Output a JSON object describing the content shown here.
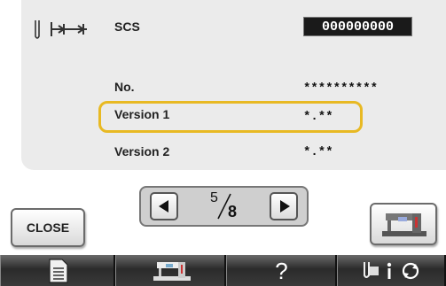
{
  "screen": {
    "header": {
      "icon": "needle-stitch-icon",
      "label": "SCS",
      "serial": "000000000"
    },
    "rows": [
      {
        "label": "No.",
        "value": "**********"
      },
      {
        "label": "Version 1",
        "value": "*.**",
        "highlighted": true
      },
      {
        "label": "Version 2",
        "value": "*.**"
      }
    ],
    "highlight_color": "#e8b923"
  },
  "buttons": {
    "close_label": "CLOSE",
    "machine_icon": "sewing-machine-icon"
  },
  "pager": {
    "current": "5",
    "total": "8",
    "prev_icon": "triangle-left-icon",
    "next_icon": "triangle-right-icon"
  },
  "toolbar": {
    "items": [
      {
        "icon": "document-icon"
      },
      {
        "icon": "sewing-machine-icon"
      },
      {
        "label": "?",
        "icon": "help-icon"
      },
      {
        "icon": "settings-info-icon"
      }
    ]
  }
}
